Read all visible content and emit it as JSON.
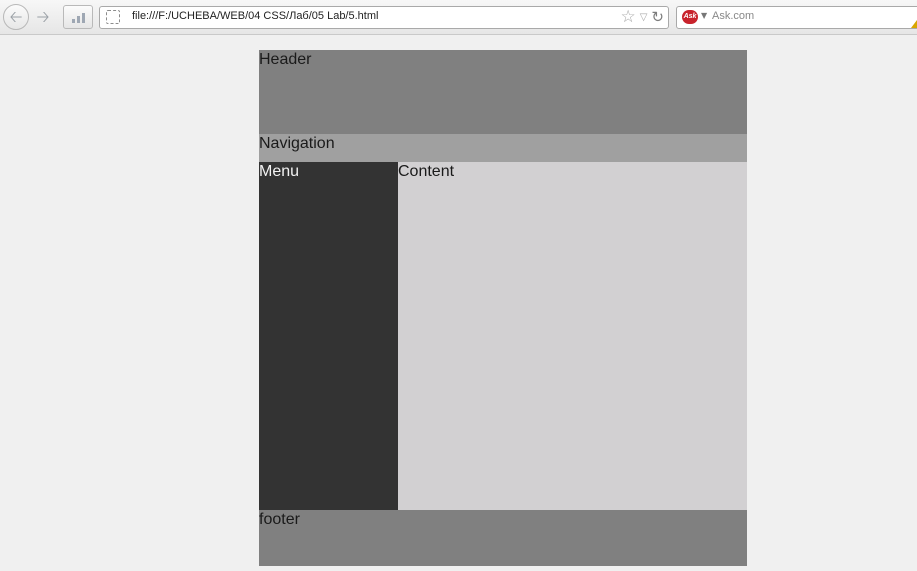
{
  "browser": {
    "address": "file:///F:/UCHEBA/WEB/04 CSS/Лаб/05 Lab/5.html",
    "search_placeholder": "Ask.com",
    "search_engine_icon": "ask-icon",
    "search_engine_badge": "Ask"
  },
  "page": {
    "header": "Header",
    "navigation": "Navigation",
    "menu": "Menu",
    "content": "Content",
    "footer": "footer"
  },
  "colors": {
    "header_bg": "#808080",
    "navigation_bg": "#a0a0a0",
    "menu_bg": "#333333",
    "content_bg": "#d2d0d2",
    "footer_bg": "#808080",
    "window_bg": "#f0f0f0"
  }
}
